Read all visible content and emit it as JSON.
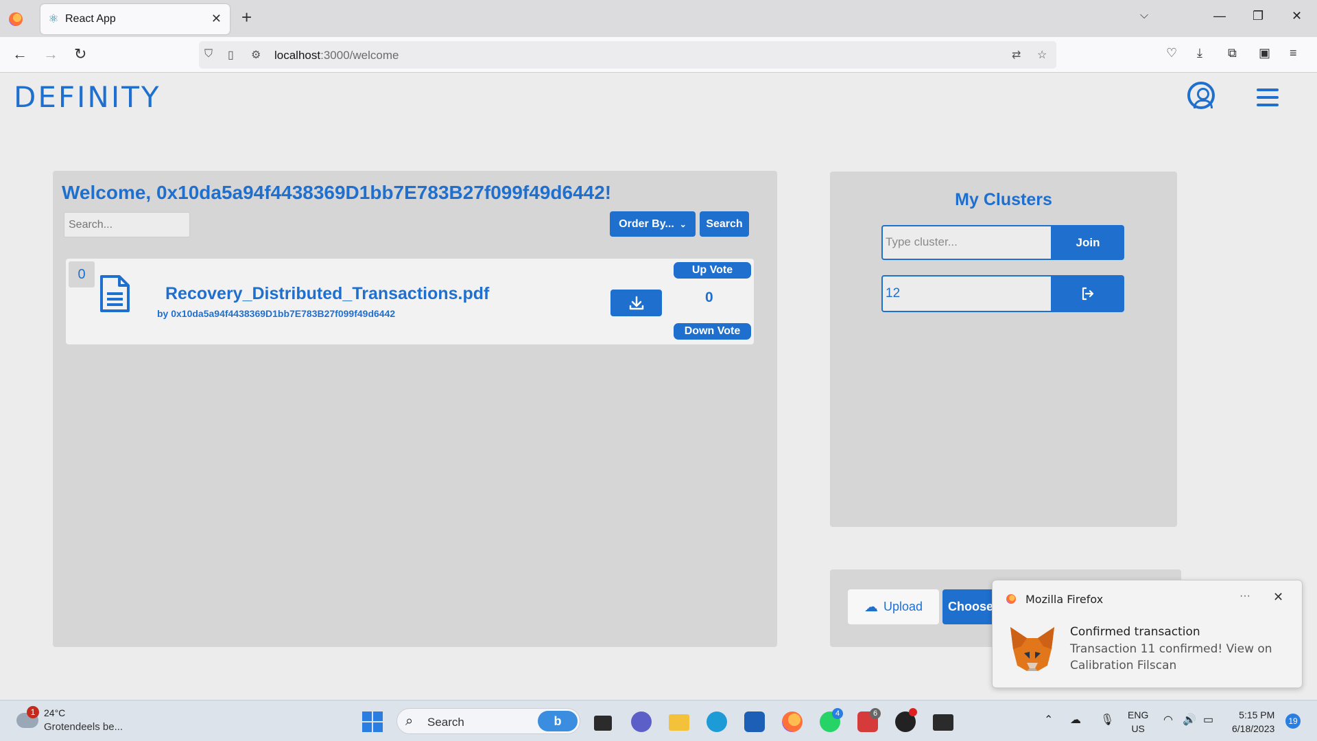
{
  "browser": {
    "tab_title": "React App",
    "url_host": "localhost",
    "url_path": ":3000/welcome"
  },
  "app": {
    "logo": "DEFINITY",
    "welcome_text": "Welcome, 0x10da5a94f4438369D1bb7E783B27f099f49d6442!",
    "search_placeholder": "Search...",
    "order_by_label": "Order By...",
    "search_button": "Search",
    "files": [
      {
        "index": "0",
        "name": "Recovery_Distributed_Transactions.pdf",
        "author": "by 0x10da5a94f4438369D1bb7E783B27f099f49d6442",
        "votes": "0",
        "upvote_label": "Up Vote",
        "downvote_label": "Down Vote"
      }
    ],
    "clusters": {
      "title": "My Clusters",
      "input_placeholder": "Type cluster...",
      "join_label": "Join",
      "current_cluster": "12"
    },
    "upload": {
      "upload_label": "Upload",
      "choose_label": "Choose"
    },
    "accent_color": "#1f6fcf"
  },
  "notification": {
    "app_name": "Mozilla Firefox",
    "more": "···",
    "title": "Confirmed transaction",
    "body": "Transaction 11 confirmed! View on Calibration Filscan"
  },
  "taskbar": {
    "weather_badge": "1",
    "temperature": "24°C",
    "weather_desc": "Grotendeels be...",
    "search_label": "Search",
    "whatsapp_badge": "4",
    "app_badge": "6",
    "lang_line1": "ENG",
    "lang_line2": "US",
    "time": "5:15 PM",
    "date": "6/18/2023",
    "notification_count": "19"
  }
}
